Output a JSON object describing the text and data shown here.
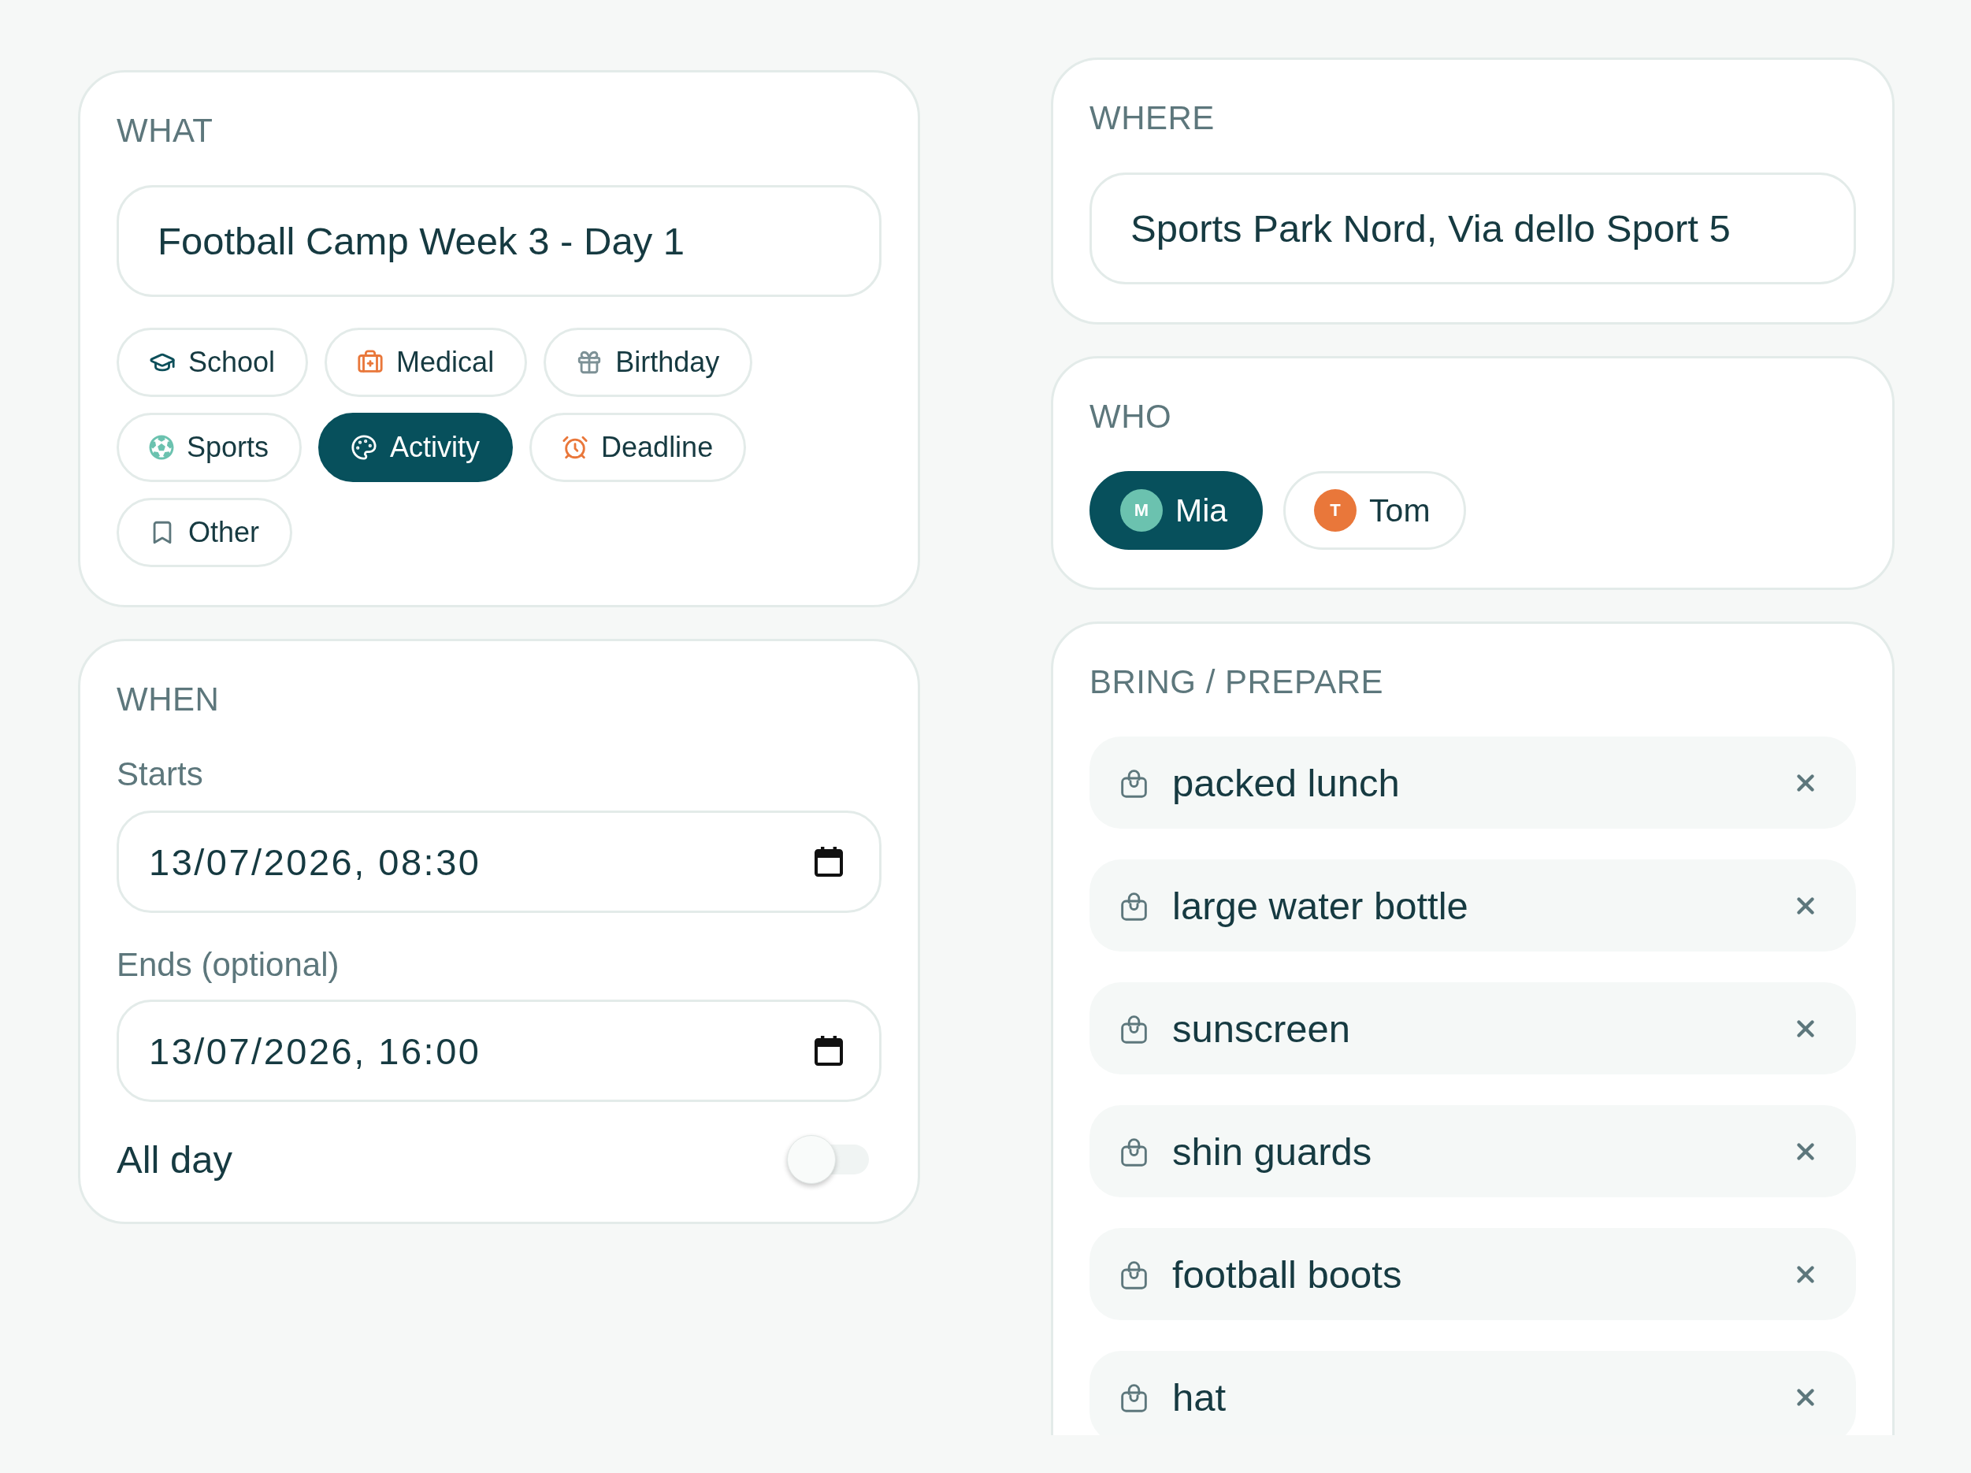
{
  "what": {
    "heading": "WHAT",
    "title": "Football Camp Week 3 - Day 1",
    "categories": [
      {
        "label": "School",
        "selected": false
      },
      {
        "label": "Medical",
        "selected": false
      },
      {
        "label": "Birthday",
        "selected": false
      },
      {
        "label": "Sports",
        "selected": false
      },
      {
        "label": "Activity",
        "selected": true
      },
      {
        "label": "Deadline",
        "selected": false
      },
      {
        "label": "Other",
        "selected": false
      }
    ]
  },
  "when": {
    "heading": "WHEN",
    "start": {
      "label": "Starts",
      "value": "13/07/2026, 08:30"
    },
    "end": {
      "label": "Ends (optional)",
      "value": "13/07/2026, 16:00"
    },
    "all_day": {
      "label": "All day",
      "on": false
    }
  },
  "where": {
    "heading": "WHERE",
    "value": "Sports Park Nord, Via dello Sport 5"
  },
  "who": {
    "heading": "WHO",
    "people": [
      {
        "initial": "M",
        "name": "Mia",
        "color": "#6bc2af",
        "selected": true
      },
      {
        "initial": "T",
        "name": "Tom",
        "color": "#e9773a",
        "selected": false
      }
    ]
  },
  "bring": {
    "heading": "BRING / PREPARE",
    "items": [
      "packed lunch",
      "large water bottle",
      "sunscreen",
      "shin guards",
      "football boots",
      "hat"
    ]
  }
}
